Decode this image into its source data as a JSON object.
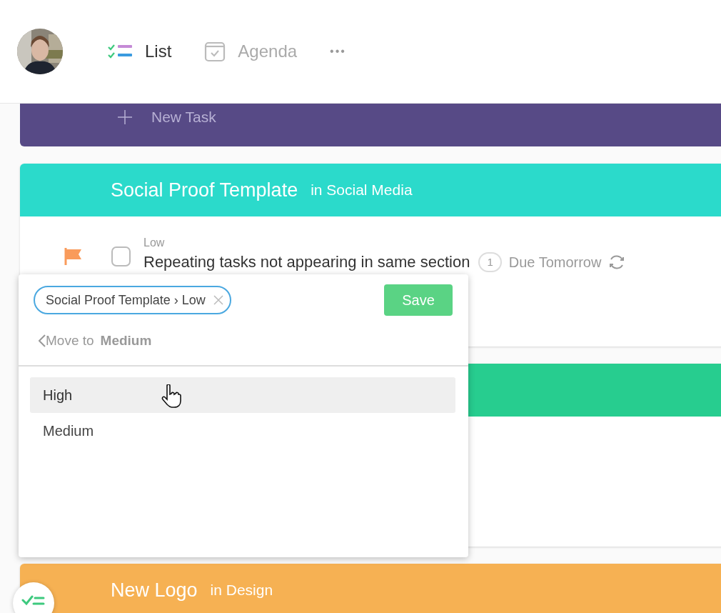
{
  "header": {
    "views": [
      {
        "label": "List",
        "kind": "list",
        "selected": true
      },
      {
        "label": "Agenda",
        "kind": "agenda",
        "selected": false
      }
    ],
    "more": "•••"
  },
  "top_section": {
    "color": "#574a86",
    "new_task": "New Task"
  },
  "projects": [
    {
      "title": "Social Proof Template",
      "context": "in Social Media",
      "color": "#2bdacb",
      "kind": "card",
      "tasks": [
        {
          "priority": "Low",
          "title": "Repeating tasks not appearing in same section",
          "checked": false,
          "comments": "1",
          "due": "Due Tomorrow",
          "repeating": true
        }
      ]
    },
    {
      "color": "#27cd8f",
      "kind": "card"
    },
    {
      "title": "New Logo",
      "context": "in Design",
      "color": "#f6b153",
      "kind": "header"
    }
  ],
  "move_popup": {
    "tag": "Social Proof Template › Low",
    "save": "Save",
    "back_label": "Move to",
    "target": "Medium",
    "options": [
      {
        "label": "High",
        "selected": true
      },
      {
        "label": "Medium",
        "selected": false
      }
    ]
  }
}
